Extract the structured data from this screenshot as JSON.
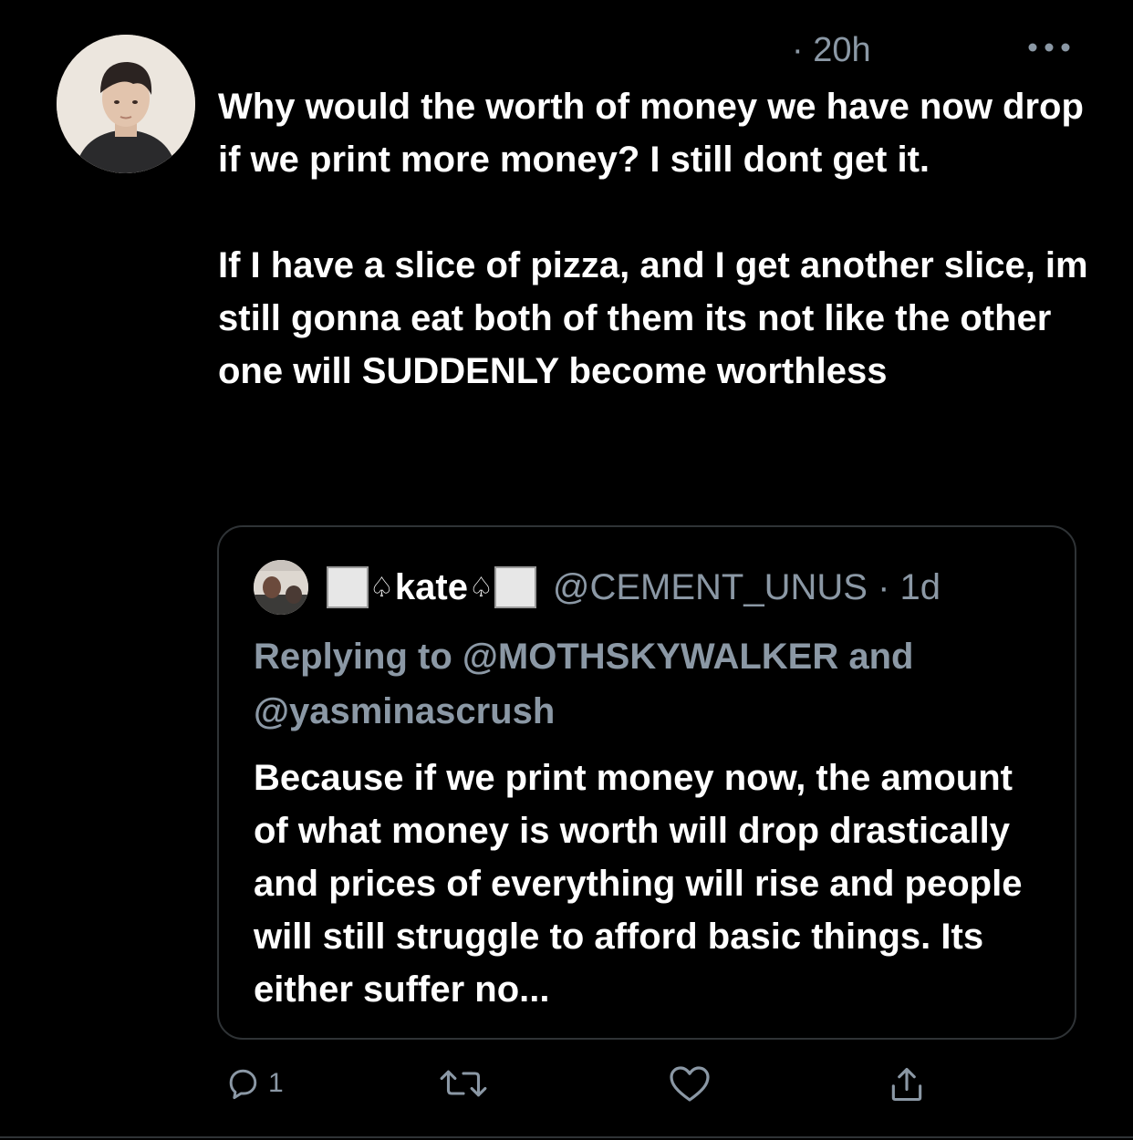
{
  "tweet": {
    "timestamp": "· 20h",
    "more_icon": "more-horizontal-icon",
    "text": [
      "Why would the worth of money we have now drop if we print more money? I still dont get it.",
      "If I have a slice of pizza, and I get another slice, im still gonna eat both of them its not like the other one will SUDDENLY become worthless"
    ]
  },
  "quote": {
    "name_text": "kate",
    "name_symbol": "♤",
    "handle_time": "@CEMENT_UNUS · 1d",
    "replying_to": "Replying to @MOTHSKYWALKER and @yasminascrush",
    "text": "Because if we print money now, the amount of what money is worth will drop drastically and prices of everything will rise and people will still struggle to afford basic things. Its either suffer no..."
  },
  "actions": {
    "reply_icon": "reply-icon",
    "reply_count": "1",
    "retweet_icon": "retweet-icon",
    "like_icon": "heart-icon",
    "share_icon": "share-icon"
  },
  "colors": {
    "background": "#000000",
    "text": "#ffffff",
    "secondary": "#8b98a5",
    "border": "#2f3336"
  }
}
